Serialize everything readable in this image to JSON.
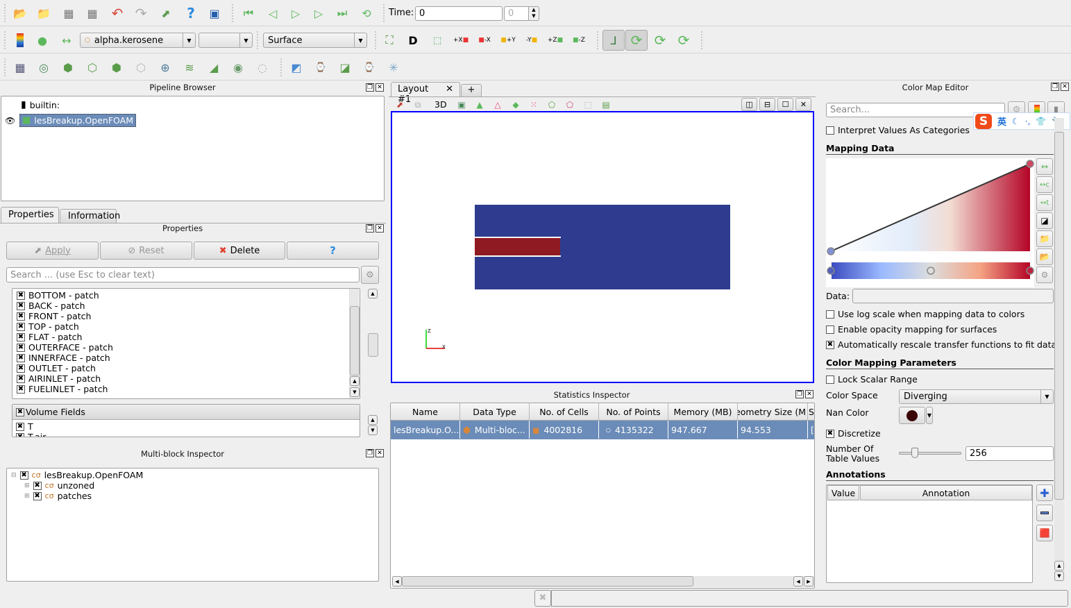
{
  "toolbar_main": {
    "icons": [
      "open-file-icon",
      "load-state-icon",
      "connect-icon",
      "disconnect-icon",
      "undo-icon",
      "redo-icon",
      "save-state-icon",
      "help-icon",
      "pick-center-icon"
    ],
    "vcr": [
      "first-frame-icon",
      "previous-frame-icon",
      "play-icon",
      "next-frame-icon",
      "last-frame-icon",
      "loop-icon"
    ],
    "time_label": "Time:",
    "time_value": "0",
    "time_index": "0"
  },
  "toolbar_display": {
    "color_array": "alpha.kerosene",
    "component": "",
    "representation": "Surface",
    "camera_buttons": [
      "reset-camera-icon",
      "zoom-to-data-icon",
      "zoom-to-box-icon",
      "view-plus-x-icon",
      "view-minus-x-icon",
      "view-plus-y-icon",
      "view-minus-y-icon",
      "view-plus-z-icon",
      "view-minus-z-icon"
    ],
    "camera_labels": [
      "",
      "D",
      "",
      "+X",
      "-X",
      "+Y",
      "-Y",
      "+Z",
      "-Z"
    ],
    "interaction_buttons": [
      "show-orientation-axes-icon",
      "show-center-icon",
      "reset-center-icon",
      "pick-center-icon"
    ]
  },
  "toolbar_filters": {
    "icons": [
      "calculator-icon",
      "contour-icon",
      "clip-icon",
      "slice-icon",
      "threshold-icon",
      "extract-subset-icon",
      "glyph-icon",
      "stream-tracer-icon",
      "warp-vector-icon",
      "group-datasets-icon",
      "extract-level-icon",
      "plot-over-line-icon",
      "plot-selection-over-time-icon",
      "plot-data-icon",
      "probe-icon",
      "transform-icon"
    ]
  },
  "pipeline_browser": {
    "title": "Pipeline Browser",
    "items": [
      {
        "label": "builtin:",
        "icon": "server-icon"
      },
      {
        "label": "lesBreakup.OpenFOAM",
        "icon": "source-icon",
        "selected": true,
        "visible": true
      }
    ]
  },
  "tabs": [
    {
      "label": "Properties",
      "active": true
    },
    {
      "label": "Information",
      "active": false
    }
  ],
  "properties": {
    "title": "Properties",
    "apply_label": "Apply",
    "reset_label": "Reset",
    "delete_label": "Delete",
    "help_label": "?",
    "search_placeholder": "Search ... (use Esc to clear text)",
    "patches": [
      {
        "label": "BOTTOM - patch",
        "checked": true
      },
      {
        "label": "BACK - patch",
        "checked": true
      },
      {
        "label": "FRONT - patch",
        "checked": true
      },
      {
        "label": "TOP - patch",
        "checked": true
      },
      {
        "label": "FLAT - patch",
        "checked": true
      },
      {
        "label": "OUTERFACE - patch",
        "checked": true
      },
      {
        "label": "INNERFACE - patch",
        "checked": true
      },
      {
        "label": "OUTLET - patch",
        "checked": true
      },
      {
        "label": "AIRINLET - patch",
        "checked": true
      },
      {
        "label": "FUELINLET - patch",
        "checked": true
      }
    ],
    "volume_fields_header": "Volume Fields",
    "volume_fields": [
      {
        "label": "T",
        "checked": true
      },
      {
        "label": "T.air",
        "checked": true
      }
    ]
  },
  "multiblock": {
    "title": "Multi-block Inspector",
    "root": "lesBreakup.OpenFOAM",
    "children": [
      "unzoned",
      "patches"
    ]
  },
  "layout": {
    "tab_label": "Layout #1",
    "add_tab": "+",
    "view_label_3d": "3D",
    "view_buttons": [
      "split-horizontal-icon",
      "split-vertical-icon",
      "maximize-icon",
      "close-view-icon"
    ],
    "render_colors": {
      "fluid": "#2e3b8e",
      "jet": "#8f1a22",
      "background": "#ffffff",
      "active_border": "#0000ff"
    },
    "axes": {
      "x": "X",
      "z": "Z"
    }
  },
  "statistics": {
    "title": "Statistics Inspector",
    "columns": [
      "Name",
      "Data Type",
      "No. of Cells",
      "No. of Points",
      "Memory (MB)",
      "eometry Size (M",
      "S"
    ],
    "rows": [
      {
        "name": "lesBreakup.O...",
        "data_type": "Multi-bloc...",
        "cells": "4002816",
        "points": "4135322",
        "memory": "947.667",
        "geometry_size": "94.553",
        "extra": "["
      }
    ]
  },
  "color_map_editor": {
    "title": "Color Map Editor",
    "search_placeholder": "Search...",
    "interpret_categories": {
      "label": "Interpret Values As Categories",
      "checked": false
    },
    "mapping_data_header": "Mapping Data",
    "data_label": "Data:",
    "data_value": "",
    "log_scale": {
      "label": "Use log scale when mapping data to colors",
      "checked": false
    },
    "opacity_mapping": {
      "label": "Enable opacity mapping for surfaces",
      "checked": false
    },
    "auto_rescale": {
      "label": "Automatically rescale transfer functions to fit data",
      "checked": true
    },
    "params_header": "Color Mapping Parameters",
    "lock_range": {
      "label": "Lock Scalar Range",
      "checked": false
    },
    "color_space_label": "Color Space",
    "color_space": "Diverging",
    "nan_color_label": "Nan Color",
    "nan_color": "#3a0505",
    "discretize": {
      "label": "Discretize",
      "checked": true
    },
    "table_values_label_1": "Number Of",
    "table_values_label_2": "Table Values",
    "table_values": "256",
    "annotations_header": "Annotations",
    "annotation_columns": [
      "Value",
      "Annotation"
    ],
    "colormap": {
      "low": "#3b4cc0",
      "mid": "#dddddd",
      "high": "#b40426"
    }
  },
  "ime_bar": {
    "label": "英"
  }
}
